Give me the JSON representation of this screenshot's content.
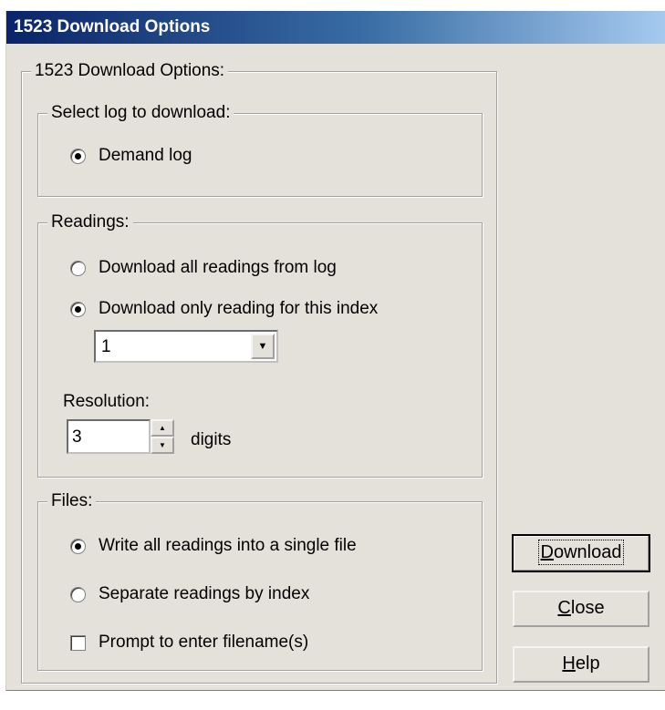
{
  "window": {
    "title": "1523 Download Options"
  },
  "outer_group": {
    "label": "1523 Download Options:"
  },
  "log_group": {
    "label": "Select log to download:",
    "options": [
      {
        "label": "Demand log",
        "checked": true
      }
    ]
  },
  "readings_group": {
    "label": "Readings:",
    "options": [
      {
        "label": "Download all readings from log",
        "checked": false
      },
      {
        "label": "Download only reading for this index",
        "checked": true
      }
    ],
    "index_select": {
      "value": "1"
    },
    "resolution": {
      "label": "Resolution:",
      "value": "3",
      "unit": "digits"
    }
  },
  "files_group": {
    "label": "Files:",
    "options": [
      {
        "label": "Write all readings into a single file",
        "checked": true
      },
      {
        "label": "Separate readings by index",
        "checked": false
      }
    ],
    "prompt_checkbox": {
      "label": "Prompt to enter filename(s)",
      "checked": false
    }
  },
  "buttons": {
    "download": {
      "mnemonic": "D",
      "rest": "ownload"
    },
    "close": {
      "mnemonic": "C",
      "rest": "lose"
    },
    "help": {
      "mnemonic": "H",
      "rest": "elp"
    }
  }
}
